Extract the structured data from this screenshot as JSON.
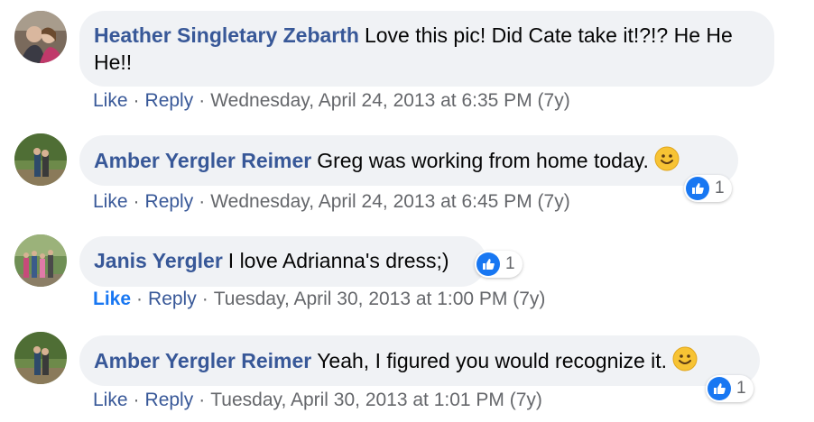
{
  "comments": [
    {
      "author": "Heather Singletary Zebarth",
      "text": "Love this pic! Did Cate take it!?!? He He He!!",
      "like": "Like",
      "reply": "Reply",
      "timestamp": "Wednesday, April 24, 2013 at 6:35 PM (7y)"
    },
    {
      "author": "Amber Yergler Reimer",
      "text": "Greg was working from home today.",
      "like": "Like",
      "reply": "Reply",
      "timestamp": "Wednesday, April 24, 2013 at 6:45 PM (7y)",
      "reaction_count": "1",
      "emoji": "smile-emoji"
    },
    {
      "author": "Janis Yergler",
      "text": "I love Adrianna's dress;)",
      "like": "Like",
      "reply": "Reply",
      "timestamp": "Tuesday, April 30, 2013 at 1:00 PM (7y)",
      "reaction_count": "1",
      "liked": true
    },
    {
      "author": "Amber Yergler Reimer",
      "text": "Yeah, I figured you would recognize it.",
      "like": "Like",
      "reply": "Reply",
      "timestamp": "Tuesday, April 30, 2013 at 1:01 PM (7y)",
      "reaction_count": "1",
      "emoji": "smile-emoji"
    }
  ],
  "colors": {
    "author": "#385898",
    "bubble": "#f0f2f5",
    "like_blue": "#1877f2",
    "meta": "#65676b"
  }
}
